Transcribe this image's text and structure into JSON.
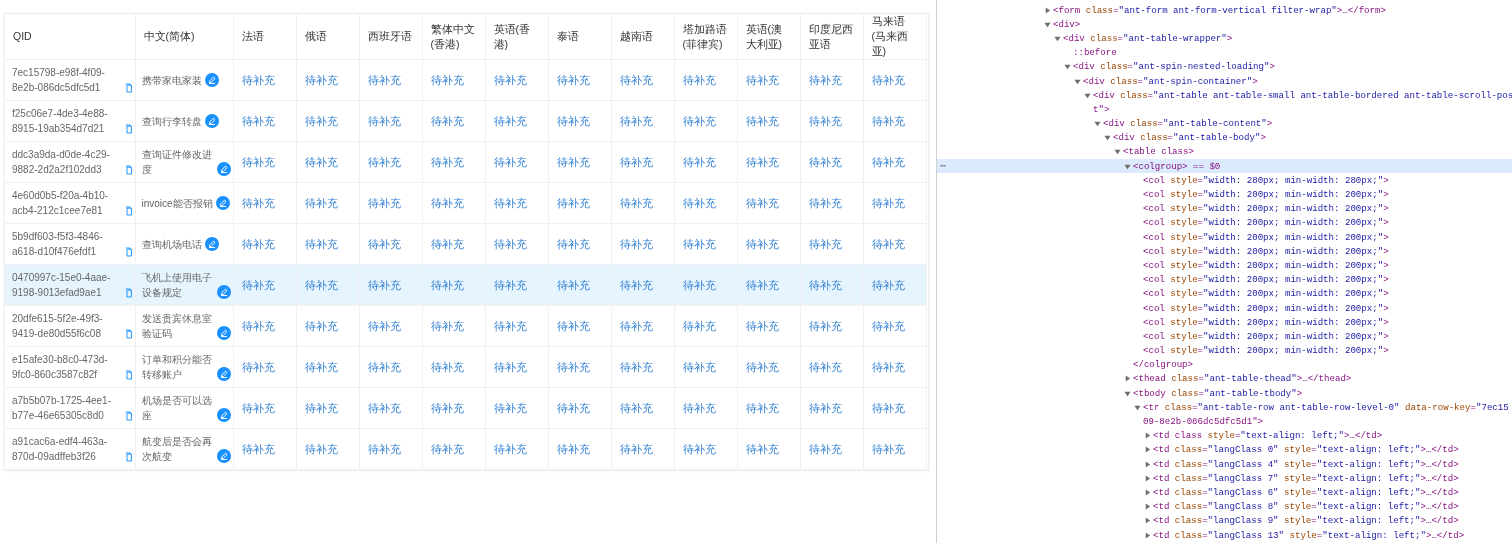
{
  "table": {
    "columns": [
      "QID",
      "中文(简体)",
      "法语",
      "俄语",
      "西班牙语",
      "繁体中文(香港)",
      "英语(香港)",
      "泰语",
      "越南语",
      "塔加路语(菲律宾)",
      "英语(澳大利亚)",
      "印度尼西亚语",
      "马来语(马来西亚)"
    ],
    "rows": [
      {
        "cells": [
          "7ec15798-e98f-4f09-8e2b-086dc5dfc5d1",
          "携带家电家装",
          "待补充",
          "待补充",
          "待补充",
          "待补充",
          "待补充",
          "待补充",
          "待补充",
          "待补充",
          "待补充",
          "待补充",
          "待补充"
        ],
        "selected": false
      },
      {
        "cells": [
          "f25c06e7-4de3-4e88-8915-19ab354d7d21",
          "查询行李转盘",
          "待补充",
          "待补充",
          "待补充",
          "待补充",
          "待补充",
          "待补充",
          "待补充",
          "待补充",
          "待补充",
          "待补充",
          "待补充"
        ],
        "selected": false
      },
      {
        "cells": [
          "ddc3a9da-d0de-4c29-9882-2d2a2f102dd3",
          "查询证件修改进度",
          "待补充",
          "待补充",
          "待补充",
          "待补充",
          "待补充",
          "待补充",
          "待补充",
          "待补充",
          "待补充",
          "待补充",
          "待补充"
        ],
        "selected": false
      },
      {
        "cells": [
          "4e60d0b5-f20a-4b10-acb4-212c1cee7e81",
          "invoice能否报销",
          "待补充",
          "待补充",
          "待补充",
          "待补充",
          "待补充",
          "待补充",
          "待补充",
          "待补充",
          "待补充",
          "待补充",
          "待补充"
        ],
        "selected": false
      },
      {
        "cells": [
          "5b9df603-f5f3-4846-a618-d10f476efdf1",
          "查询机场电话",
          "待补充",
          "待补充",
          "待补充",
          "待补充",
          "待补充",
          "待补充",
          "待补充",
          "待补充",
          "待补充",
          "待补充",
          "待补充"
        ],
        "selected": false
      },
      {
        "cells": [
          "0470997c-15e0-4aae-9198-9013efad9ae1",
          "飞机上使用电子设备规定",
          "待补充",
          "待补充",
          "待补充",
          "待补充",
          "待补充",
          "待补充",
          "待补充",
          "待补充",
          "待补充",
          "待补充",
          "待补充"
        ],
        "selected": true
      },
      {
        "cells": [
          "20dfe615-5f2e-49f3-9419-de80d55f6c08",
          "发送贵宾休息室验证码",
          "待补充",
          "待补充",
          "待补充",
          "待补充",
          "待补充",
          "待补充",
          "待补充",
          "待补充",
          "待补充",
          "待补充",
          "待补充"
        ],
        "selected": false
      },
      {
        "cells": [
          "e15afe30-b8c0-473d-9fc0-860c3587c82f",
          "订单和积分能否转移账户",
          "待补充",
          "待补充",
          "待补充",
          "待补充",
          "待补充",
          "待补充",
          "待补充",
          "待补充",
          "待补充",
          "待补充",
          "待补充"
        ],
        "selected": false
      },
      {
        "cells": [
          "a7b5b07b-1725-4ee1-b77e-46e65305c8d0",
          "机场是否可以选座",
          "待补充",
          "待补充",
          "待补充",
          "待补充",
          "待补充",
          "待补充",
          "待补充",
          "待补充",
          "待补充",
          "待补充",
          "待补充"
        ],
        "selected": false
      },
      {
        "cells": [
          "a91cac6a-edf4-463a-870d-09adffeb3f26",
          "航变后是否会再次航变",
          "待补充",
          "待补充",
          "待补充",
          "待补充",
          "待补充",
          "待补充",
          "待补充",
          "待补充",
          "待补充",
          "待补充",
          "待补充"
        ],
        "selected": false
      }
    ]
  },
  "devtools": {
    "nodes": [
      {
        "kind": "element",
        "text": "<form class=\"ant-form ant-form-vertical filter-wrap\">…</form>",
        "expanded": false,
        "selected": false
      },
      {
        "kind": "element",
        "text": "<div>",
        "expanded": true,
        "selected": false,
        "children": [
          {
            "kind": "element",
            "text": "<div class=\"ant-table-wrapper\">",
            "expanded": true,
            "selected": false,
            "children": [
              {
                "kind": "leaf",
                "text": "::before",
                "selected": false
              },
              {
                "kind": "element",
                "text": "<div class=\"ant-spin-nested-loading\">",
                "expanded": true,
                "selected": false,
                "children": [
                  {
                    "kind": "element",
                    "text": "<div class=\"ant-spin-container\">",
                    "expanded": true,
                    "selected": false,
                    "children": [
                      {
                        "kind": "element",
                        "text": "<div class=\"ant-table ant-table-small ant-table-bordered ant-table-scroll-pos",
                        "continuation": "t\">",
                        "expanded": true,
                        "selected": false,
                        "children": [
                          {
                            "kind": "element",
                            "text": "<div class=\"ant-table-content\">",
                            "expanded": true,
                            "selected": false,
                            "children": [
                              {
                                "kind": "element",
                                "text": "<div class=\"ant-table-body\">",
                                "expanded": true,
                                "selected": false,
                                "children": [
                                  {
                                    "kind": "element",
                                    "text": "<table class>",
                                    "expanded": true,
                                    "selected": false,
                                    "children": [
                                      {
                                        "kind": "element",
                                        "text": "<colgroup> == $0",
                                        "closing": "</colgroup>",
                                        "expanded": true,
                                        "selected": true,
                                        "children": [
                                          {
                                            "kind": "leaf",
                                            "text": "<col style=\"width: 280px; min-width: 280px;\">",
                                            "selected": false
                                          },
                                          {
                                            "kind": "leaf",
                                            "text": "<col style=\"width: 200px; min-width: 200px;\">",
                                            "selected": false
                                          },
                                          {
                                            "kind": "leaf",
                                            "text": "<col style=\"width: 200px; min-width: 200px;\">",
                                            "selected": false
                                          },
                                          {
                                            "kind": "leaf",
                                            "text": "<col style=\"width: 200px; min-width: 200px;\">",
                                            "selected": false
                                          },
                                          {
                                            "kind": "leaf",
                                            "text": "<col style=\"width: 200px; min-width: 200px;\">",
                                            "selected": false
                                          },
                                          {
                                            "kind": "leaf",
                                            "text": "<col style=\"width: 200px; min-width: 200px;\">",
                                            "selected": false
                                          },
                                          {
                                            "kind": "leaf",
                                            "text": "<col style=\"width: 200px; min-width: 200px;\">",
                                            "selected": false
                                          },
                                          {
                                            "kind": "leaf",
                                            "text": "<col style=\"width: 200px; min-width: 200px;\">",
                                            "selected": false
                                          },
                                          {
                                            "kind": "leaf",
                                            "text": "<col style=\"width: 200px; min-width: 200px;\">",
                                            "selected": false
                                          },
                                          {
                                            "kind": "leaf",
                                            "text": "<col style=\"width: 200px; min-width: 200px;\">",
                                            "selected": false
                                          },
                                          {
                                            "kind": "leaf",
                                            "text": "<col style=\"width: 200px; min-width: 200px;\">",
                                            "selected": false
                                          },
                                          {
                                            "kind": "leaf",
                                            "text": "<col style=\"width: 200px; min-width: 200px;\">",
                                            "selected": false
                                          },
                                          {
                                            "kind": "leaf",
                                            "text": "<col style=\"width: 200px; min-width: 200px;\">",
                                            "selected": false
                                          }
                                        ]
                                      },
                                      {
                                        "kind": "element",
                                        "text": "<thead class=\"ant-table-thead\">…</thead>",
                                        "expanded": false,
                                        "selected": false
                                      },
                                      {
                                        "kind": "element",
                                        "text": "<tbody class=\"ant-table-tbody\">",
                                        "expanded": true,
                                        "selected": false,
                                        "children": [
                                          {
                                            "kind": "element",
                                            "text": "<tr class=\"ant-table-row ant-table-row-level-0\" data-row-key=\"7ec15",
                                            "continuation": "09-8e2b-086dc5dfc5d1\">",
                                            "expanded": true,
                                            "selected": false,
                                            "children": [
                                              {
                                                "kind": "element",
                                                "text": "<td class style=\"text-align: left;\">…</td>",
                                                "expanded": false,
                                                "selected": false
                                              },
                                              {
                                                "kind": "element",
                                                "text": "<td class=\"langClass 0\" style=\"text-align: left;\">…</td>",
                                                "expanded": false,
                                                "selected": false
                                              },
                                              {
                                                "kind": "element",
                                                "text": "<td class=\"langClass 4\" style=\"text-align: left;\">…</td>",
                                                "expanded": false,
                                                "selected": false
                                              },
                                              {
                                                "kind": "element",
                                                "text": "<td class=\"langClass 7\" style=\"text-align: left;\">…</td>",
                                                "expanded": false,
                                                "selected": false
                                              },
                                              {
                                                "kind": "element",
                                                "text": "<td class=\"langClass 6\" style=\"text-align: left;\">…</td>",
                                                "expanded": false,
                                                "selected": false
                                              },
                                              {
                                                "kind": "element",
                                                "text": "<td class=\"langClass 8\" style=\"text-align: left;\">…</td>",
                                                "expanded": false,
                                                "selected": false
                                              },
                                              {
                                                "kind": "element",
                                                "text": "<td class=\"langClass 9\" style=\"text-align: left;\">…</td>",
                                                "expanded": false,
                                                "selected": false
                                              },
                                              {
                                                "kind": "element",
                                                "text": "<td class=\"langClass 13\" style=\"text-align: left;\">…</td>",
                                                "expanded": false,
                                                "selected": false
                                              }
                                            ]
                                          }
                                        ]
                                      }
                                    ]
                                  }
                                ]
                              }
                            ]
                          }
                        ]
                      }
                    ]
                  }
                ]
              }
            ]
          }
        ]
      }
    ]
  },
  "selected_marker": "⋯"
}
